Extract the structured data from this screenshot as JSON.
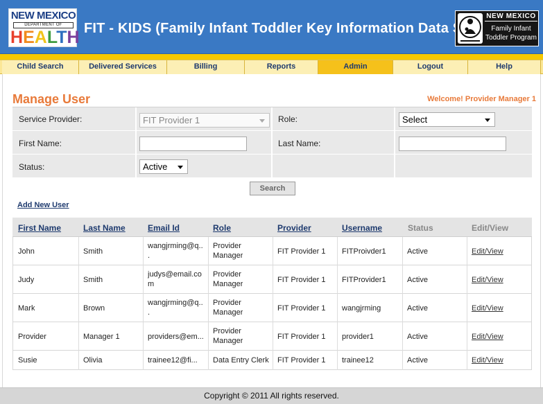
{
  "header": {
    "logo_nm_top": "NEW MEXICO",
    "logo_nm_dept": "DEPARTMENT OF",
    "logo_health": "HEALTH",
    "title": "FIT - KIDS (Family Infant Toddler Key Information Data System)",
    "fit_logo": {
      "line1": "NEW MEXICO",
      "line2": "Family Infant",
      "line3": "Toddler Program"
    }
  },
  "nav": {
    "items": [
      {
        "label": "Child Search"
      },
      {
        "label": "Delivered Services"
      },
      {
        "label": "Billing"
      },
      {
        "label": "Reports"
      },
      {
        "label": "Admin",
        "active": true
      },
      {
        "label": "Logout"
      },
      {
        "label": "Help"
      }
    ]
  },
  "page": {
    "title": "Manage User",
    "welcome": "Welcome! Provider Manager 1"
  },
  "form": {
    "service_provider_label": "Service Provider:",
    "service_provider_value": "FIT Provider 1",
    "role_label": "Role:",
    "role_value": "Select",
    "first_name_label": "First Name:",
    "first_name_value": "",
    "last_name_label": "Last Name:",
    "last_name_value": "",
    "status_label": "Status:",
    "status_value": "Active",
    "search_label": "Search"
  },
  "add_new_user": "Add New User",
  "table": {
    "headers": [
      "First Name",
      "Last Name",
      "Email Id",
      "Role",
      "Provider",
      "Username",
      "Status",
      "Edit/View"
    ],
    "rows": [
      {
        "first": "John",
        "last": "Smith",
        "email1": "wangjrming@q..",
        "email2": ".",
        "role1": "Provider",
        "role2": "Manager",
        "provider": "FIT Provider 1",
        "username": "FITProivder1",
        "status": "Active",
        "action": "Edit/View"
      },
      {
        "first": "Judy",
        "last": "Smith",
        "email1": "judys@email.co",
        "email2": "m",
        "role1": "Provider",
        "role2": "Manager",
        "provider": "FIT Provider 1",
        "username": "FITProvider1",
        "status": "Active",
        "action": "Edit/View"
      },
      {
        "first": "Mark",
        "last": "Brown",
        "email1": "wangjrming@q..",
        "email2": ".",
        "role1": "Provider",
        "role2": "Manager",
        "provider": "FIT Provider 1",
        "username": "wangjrming",
        "status": "Active",
        "action": "Edit/View"
      },
      {
        "first": "Provider",
        "last": "Manager 1",
        "email1": "providers@em...",
        "email2": "",
        "role1": "Provider",
        "role2": "Manager",
        "provider": "FIT Provider 1",
        "username": "provider1",
        "status": "Active",
        "action": "Edit/View"
      },
      {
        "first": "Susie",
        "last": "Olivia",
        "email1": "trainee12@fi...",
        "email2": "",
        "role1": "Data Entry Clerk",
        "role2": "",
        "provider": "FIT Provider 1",
        "username": "trainee12",
        "status": "Active",
        "action": "Edit/View"
      }
    ]
  },
  "footer": "Copyright © 2011 All rights reserved.",
  "colors": {
    "header_blue": "#3a79c4",
    "nav_gold": "#f5c800",
    "accent_orange": "#e87a3a",
    "link_navy": "#1e3a6e"
  },
  "icons": [
    "dropdown-arrow-icon",
    "fit-emblem-icon"
  ]
}
